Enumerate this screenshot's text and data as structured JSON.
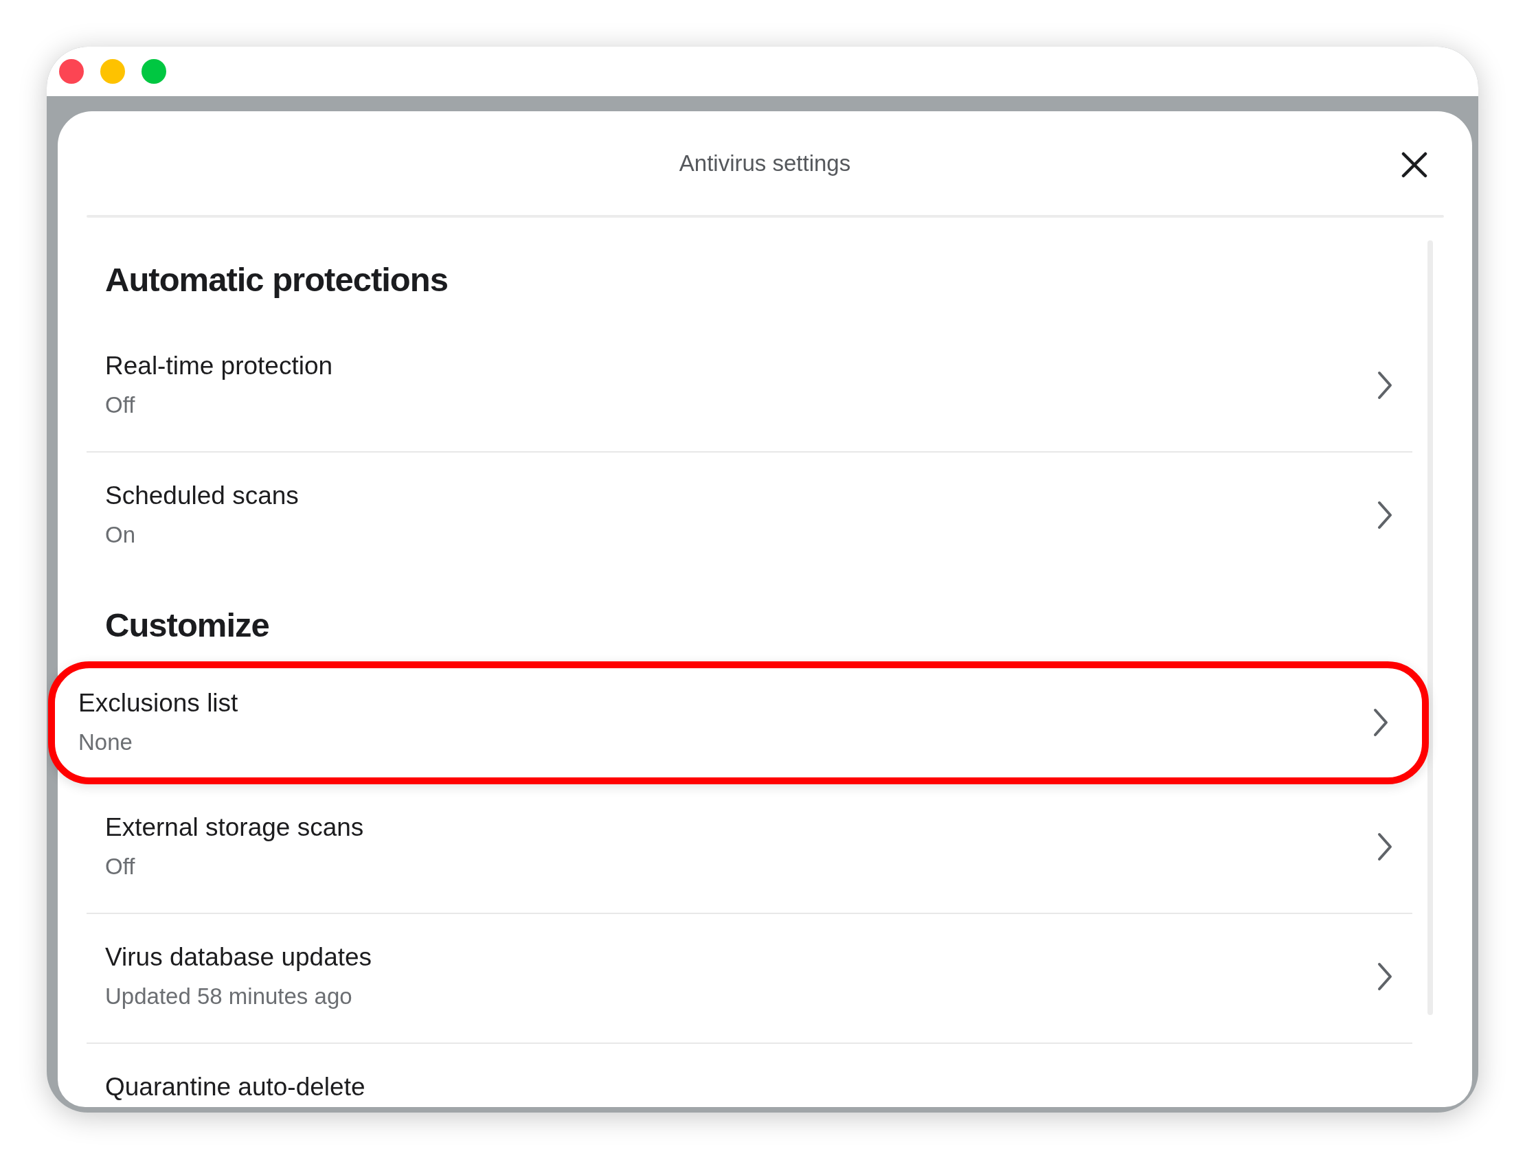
{
  "window": {
    "controls": [
      {
        "color": "#fc4553"
      },
      {
        "color": "#fec200"
      },
      {
        "color": "#00c741"
      }
    ]
  },
  "dialog": {
    "title": "Antivirus settings"
  },
  "sections": [
    {
      "heading": "Automatic protections",
      "items": [
        {
          "title": "Real-time protection",
          "status": "Off",
          "highlighted": false
        },
        {
          "title": "Scheduled scans",
          "status": "On",
          "highlighted": false
        }
      ]
    },
    {
      "heading": "Customize",
      "items": [
        {
          "title": "Exclusions list",
          "status": "None",
          "highlighted": true
        },
        {
          "title": "External storage scans",
          "status": "Off",
          "highlighted": false
        },
        {
          "title": "Virus database updates",
          "status": "Updated 58 minutes ago",
          "highlighted": false
        },
        {
          "title": "Quarantine auto-delete",
          "highlighted": false
        }
      ]
    }
  ]
}
